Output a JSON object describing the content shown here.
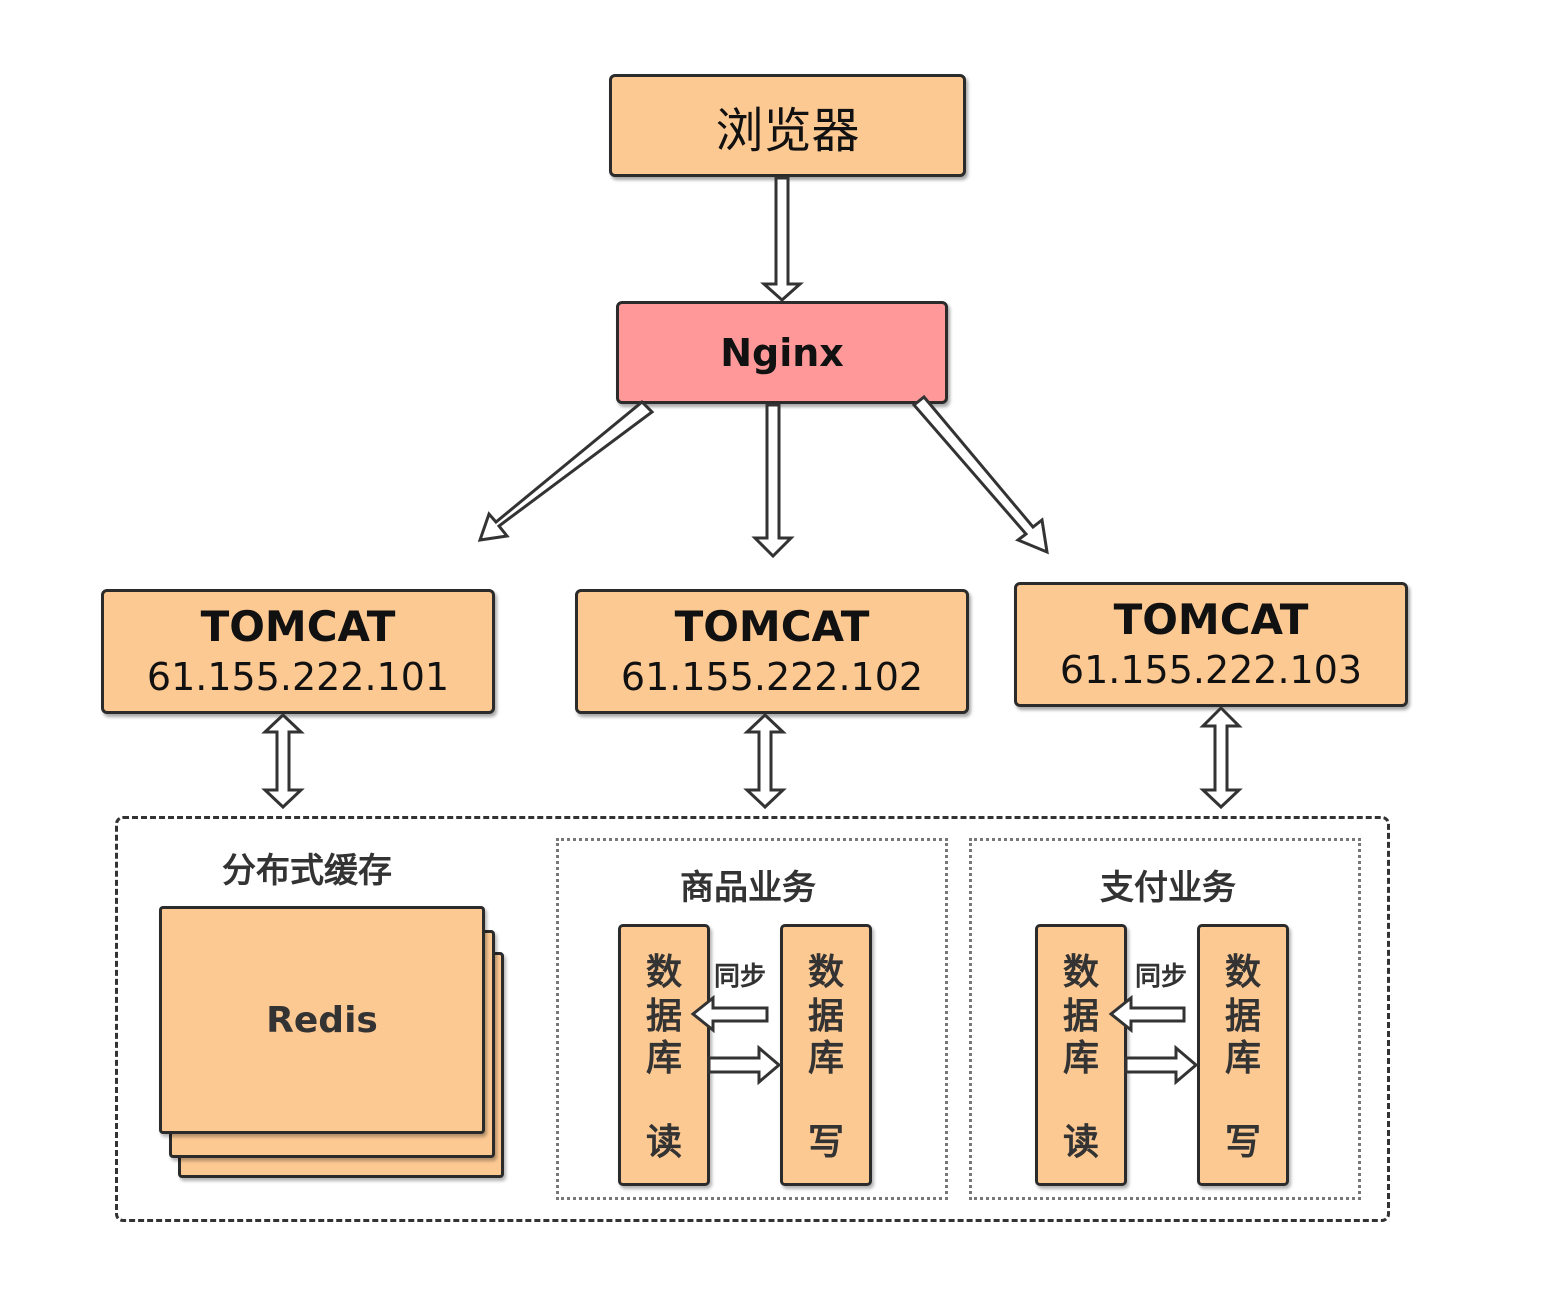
{
  "browser": {
    "label": "浏览器"
  },
  "nginx": {
    "label": "Nginx"
  },
  "tomcats": [
    {
      "title": "TOMCAT",
      "ip": "61.155.222.101"
    },
    {
      "title": "TOMCAT",
      "ip": "61.155.222.102"
    },
    {
      "title": "TOMCAT",
      "ip": "61.155.222.103"
    }
  ],
  "cache": {
    "title": "分布式缓存",
    "redis": "Redis"
  },
  "product_business": {
    "title": "商品业务",
    "sync": "同步",
    "read_db": [
      "数",
      "据",
      "库",
      "读"
    ],
    "write_db": [
      "数",
      "据",
      "库",
      "写"
    ]
  },
  "payment_business": {
    "title": "支付业务",
    "sync": "同步",
    "read_db": [
      "数",
      "据",
      "库",
      "读"
    ],
    "write_db": [
      "数",
      "据",
      "库",
      "写"
    ]
  },
  "colors": {
    "box_fill": "#fdc993",
    "nginx_fill": "#ff9999",
    "border": "#2b2b2b"
  }
}
